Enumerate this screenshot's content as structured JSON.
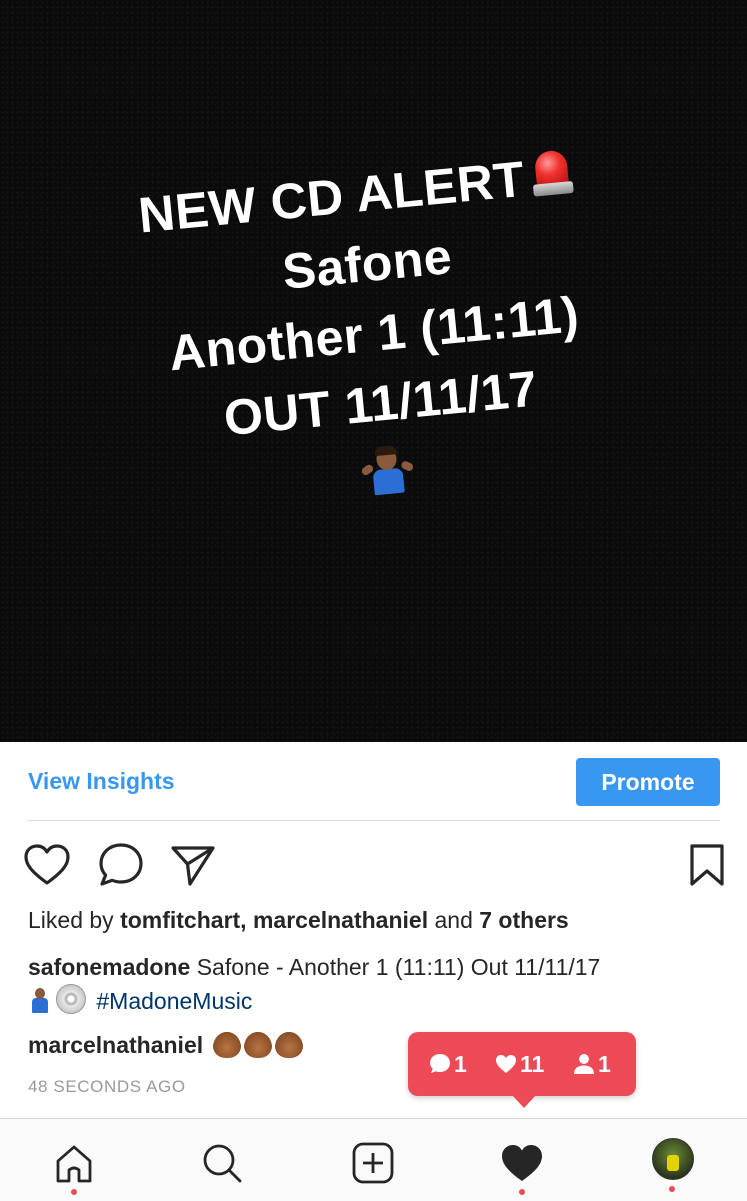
{
  "post": {
    "overlay_lines": [
      "NEW CD ALERT",
      "Safone",
      "Another 1 (11:11)",
      "OUT 11/11/17"
    ],
    "overlay_icons": [
      "rotating-light-icon",
      "person-shrugging-icon"
    ]
  },
  "insights": {
    "view_label": "View Insights",
    "promote_label": "Promote"
  },
  "actions": {
    "icons": [
      "heart-icon",
      "comment-icon",
      "share-icon",
      "bookmark-icon"
    ]
  },
  "likes": {
    "prefix": "Liked by",
    "user1": "tomfitchart,",
    "user2": "marcelnathaniel",
    "and": "and",
    "others": "7 others"
  },
  "caption": {
    "username": "safonemadone",
    "text": "Safone - Another 1 (11:11) Out 11/11/17",
    "hashtag": "#MadoneMusic"
  },
  "comment": {
    "username": "marcelnathaniel"
  },
  "timestamp": "48 SECONDS AGO",
  "notification": {
    "comments": "1",
    "likes": "11",
    "follows": "1"
  },
  "tabbar": {
    "tabs": [
      "home-icon",
      "search-icon",
      "add-post-icon",
      "activity-heart-icon",
      "profile-avatar"
    ]
  },
  "colors": {
    "link_blue": "#3897f0",
    "hashtag_blue": "#003569",
    "notification_red": "#ed4956",
    "text_dark": "#262626",
    "text_muted": "#999999"
  }
}
